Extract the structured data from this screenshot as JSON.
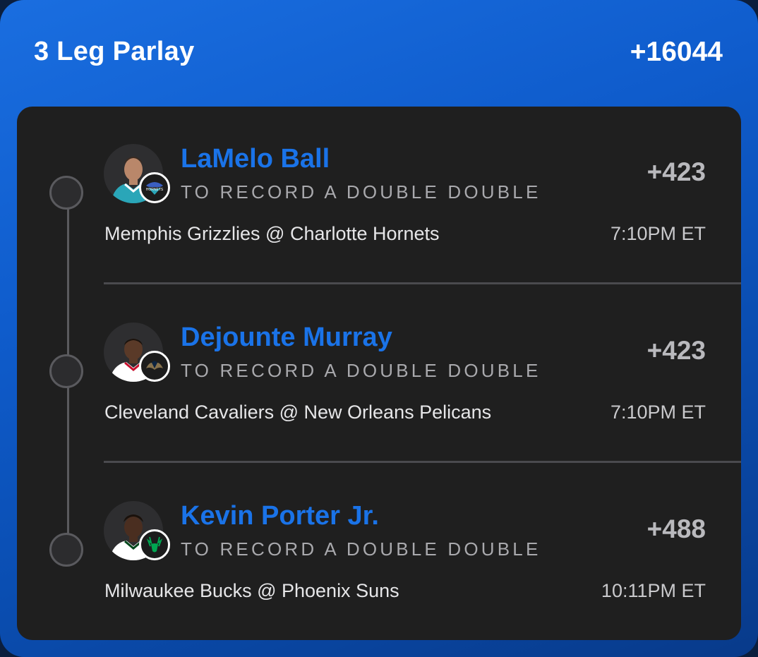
{
  "header": {
    "title": "3 Leg Parlay",
    "odds": "+16044"
  },
  "legs": [
    {
      "player": "LaMelo Ball",
      "market": "TO RECORD A DOUBLE DOUBLE",
      "odds": "+423",
      "matchup": "Memphis Grizzlies @ Charlotte Hornets",
      "time": "7:10PM ET",
      "team_icon": "hornets-logo-icon",
      "jersey_color": "#2aa6b8"
    },
    {
      "player": "Dejounte Murray",
      "market": "TO RECORD A DOUBLE DOUBLE",
      "odds": "+423",
      "matchup": "Cleveland Cavaliers @ New Orleans Pelicans",
      "time": "7:10PM ET",
      "team_icon": "pelicans-logo-icon",
      "jersey_color": "#ffffff"
    },
    {
      "player": "Kevin Porter Jr.",
      "market": "TO RECORD A DOUBLE DOUBLE",
      "odds": "+488",
      "matchup": "Milwaukee Bucks @ Phoenix Suns",
      "time": "10:11PM ET",
      "team_icon": "bucks-logo-icon",
      "jersey_color": "#ffffff"
    }
  ],
  "colors": {
    "accent_blue": "#1a73e8",
    "panel": "#1f1f1f",
    "header_gradient_start": "#1a6ee0",
    "header_gradient_end": "#083a8a"
  }
}
